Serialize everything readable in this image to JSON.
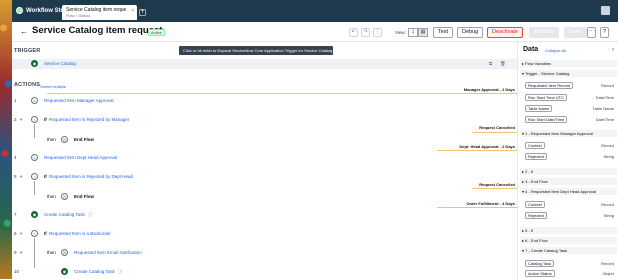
{
  "app": {
    "brand": "Workflow Studio"
  },
  "tab": {
    "title": "Service Catalog item reque",
    "subtitle": "Flow • Global"
  },
  "header": {
    "title": "Service Catalog item request",
    "status": "Active",
    "view_label": "View:",
    "buttons": {
      "test": "Test",
      "debug": "Debug",
      "deactivate": "Deactivate",
      "activate": "Activate",
      "save": "Save"
    }
  },
  "tooltip": "Click or hit enter to Expand ServiceNow Core Application Trigger for Service Catalog",
  "trigger": {
    "heading": "TRIGGER",
    "name": "Service Catalog"
  },
  "actions": {
    "heading": "ACTIONS",
    "select_multiple": "Select multiple",
    "rows": [
      {
        "num": "1",
        "label": "Requested Item Manager Approval"
      },
      {
        "num": "2",
        "prefix": "If",
        "label": "Requested Item is Rejected by Manager"
      },
      {
        "then": "then",
        "label": "End Flow"
      },
      {
        "num": "4",
        "label": "Requested Item Dept Head Approval"
      },
      {
        "num": "5",
        "prefix": "If",
        "label": "Requested Item is Rejected by Dept Head"
      },
      {
        "then": "then",
        "label": "End Flow"
      },
      {
        "num": "7",
        "label": "Create Catalog Task"
      },
      {
        "num": "8",
        "prefix": "If",
        "label": "Requested Item is a Backorder"
      },
      {
        "then": "then",
        "label": "Requested Item Email Notification"
      },
      {
        "label": "Create Catalog Task"
      }
    ],
    "stages": [
      "Manager Approval - 2 Days",
      "Request Cancelled",
      "Dept. Head Approval - 2 Days",
      "Request Cancelled",
      "Order Fulfillment - 4 Days"
    ],
    "end_nums": [
      "3",
      "6",
      "9",
      "10"
    ]
  },
  "data_panel": {
    "title": "Data",
    "collapse_all": "Collapse All",
    "sections": [
      {
        "label": "Flow Variables"
      },
      {
        "label": "Trigger - Service Catalog",
        "pills": [
          {
            "name": "Requested Item Record",
            "type": "Record"
          },
          {
            "name": "Run Start Time UTC",
            "type": "Date/Time"
          },
          {
            "name": "Table Name",
            "type": "Table Name"
          },
          {
            "name": "Run Start Date/Time",
            "type": "Date/Time"
          }
        ]
      },
      {
        "label": "1 - Requested Item Manager Approval",
        "pills": [
          {
            "name": "Context",
            "type": "Record"
          },
          {
            "name": "Rejected",
            "type": "String"
          }
        ]
      },
      {
        "label": "2 - If"
      },
      {
        "label": "3 - End Flow"
      },
      {
        "label": "4 - Requested Item Dept Head Approval",
        "pills": [
          {
            "name": "Context",
            "type": "Record"
          },
          {
            "name": "Rejected",
            "type": "String"
          }
        ]
      },
      {
        "label": "5 - If"
      },
      {
        "label": "6 - End Flow"
      },
      {
        "label": "7 - Create Catalog Task",
        "pills": [
          {
            "name": "Catalog Task",
            "type": "Record"
          },
          {
            "name": "Action Status",
            "type": "Object"
          }
        ]
      }
    ]
  }
}
